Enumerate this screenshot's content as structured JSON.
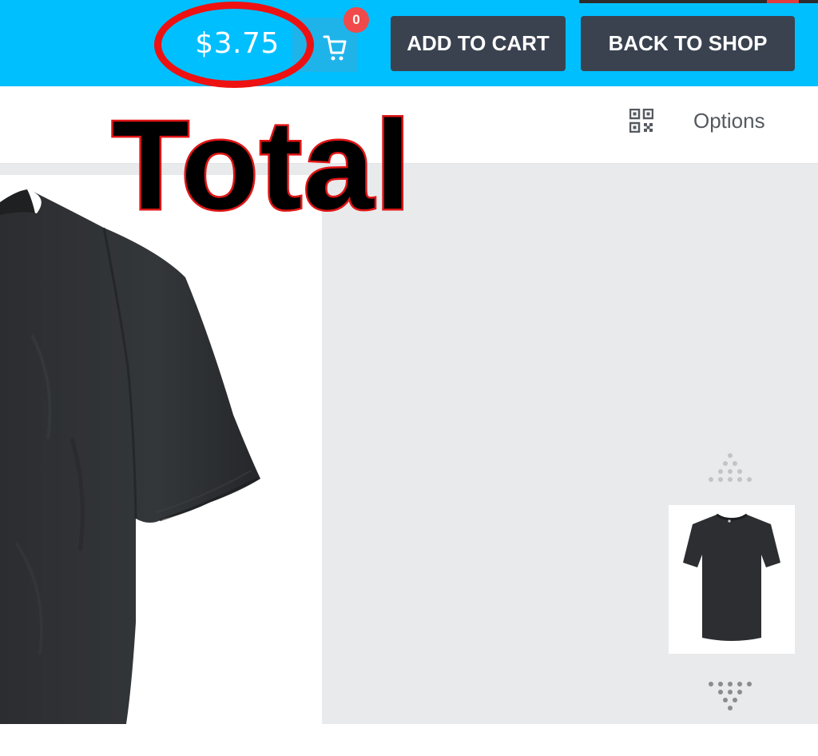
{
  "header": {
    "total_price": "$3.75",
    "cart_count": "0",
    "add_to_cart_label": "ADD TO CART",
    "back_to_shop_label": "BACK TO SHOP",
    "cart_icon": "cart-icon"
  },
  "annotation": {
    "label": "Total",
    "circle_color": "#ee1111"
  },
  "toolbar": {
    "qr_icon": "qr-code-icon",
    "options_label": "Options"
  },
  "preview": {
    "product_image": "black-tshirt",
    "thumbnail_image": "black-tshirt-thumbnail"
  },
  "colors": {
    "header_bg": "#00bfff",
    "button_bg": "#3a4250",
    "badge_bg": "#f04a4a",
    "panel_bg": "#e9eaec"
  }
}
